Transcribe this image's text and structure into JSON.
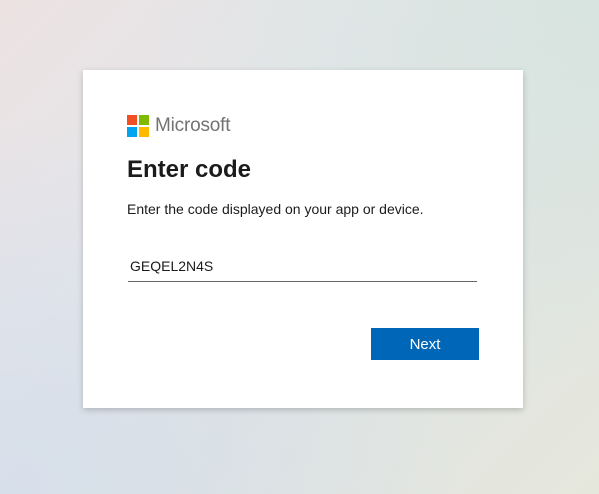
{
  "brand": {
    "name": "Microsoft",
    "logo_colors": [
      "#f25022",
      "#7fba00",
      "#00a4ef",
      "#ffb900"
    ]
  },
  "form": {
    "title": "Enter code",
    "description": "Enter the code displayed on your app or device.",
    "code_value": "GEQEL2N4S",
    "next_label": "Next"
  },
  "colors": {
    "accent": "#0067b8"
  }
}
